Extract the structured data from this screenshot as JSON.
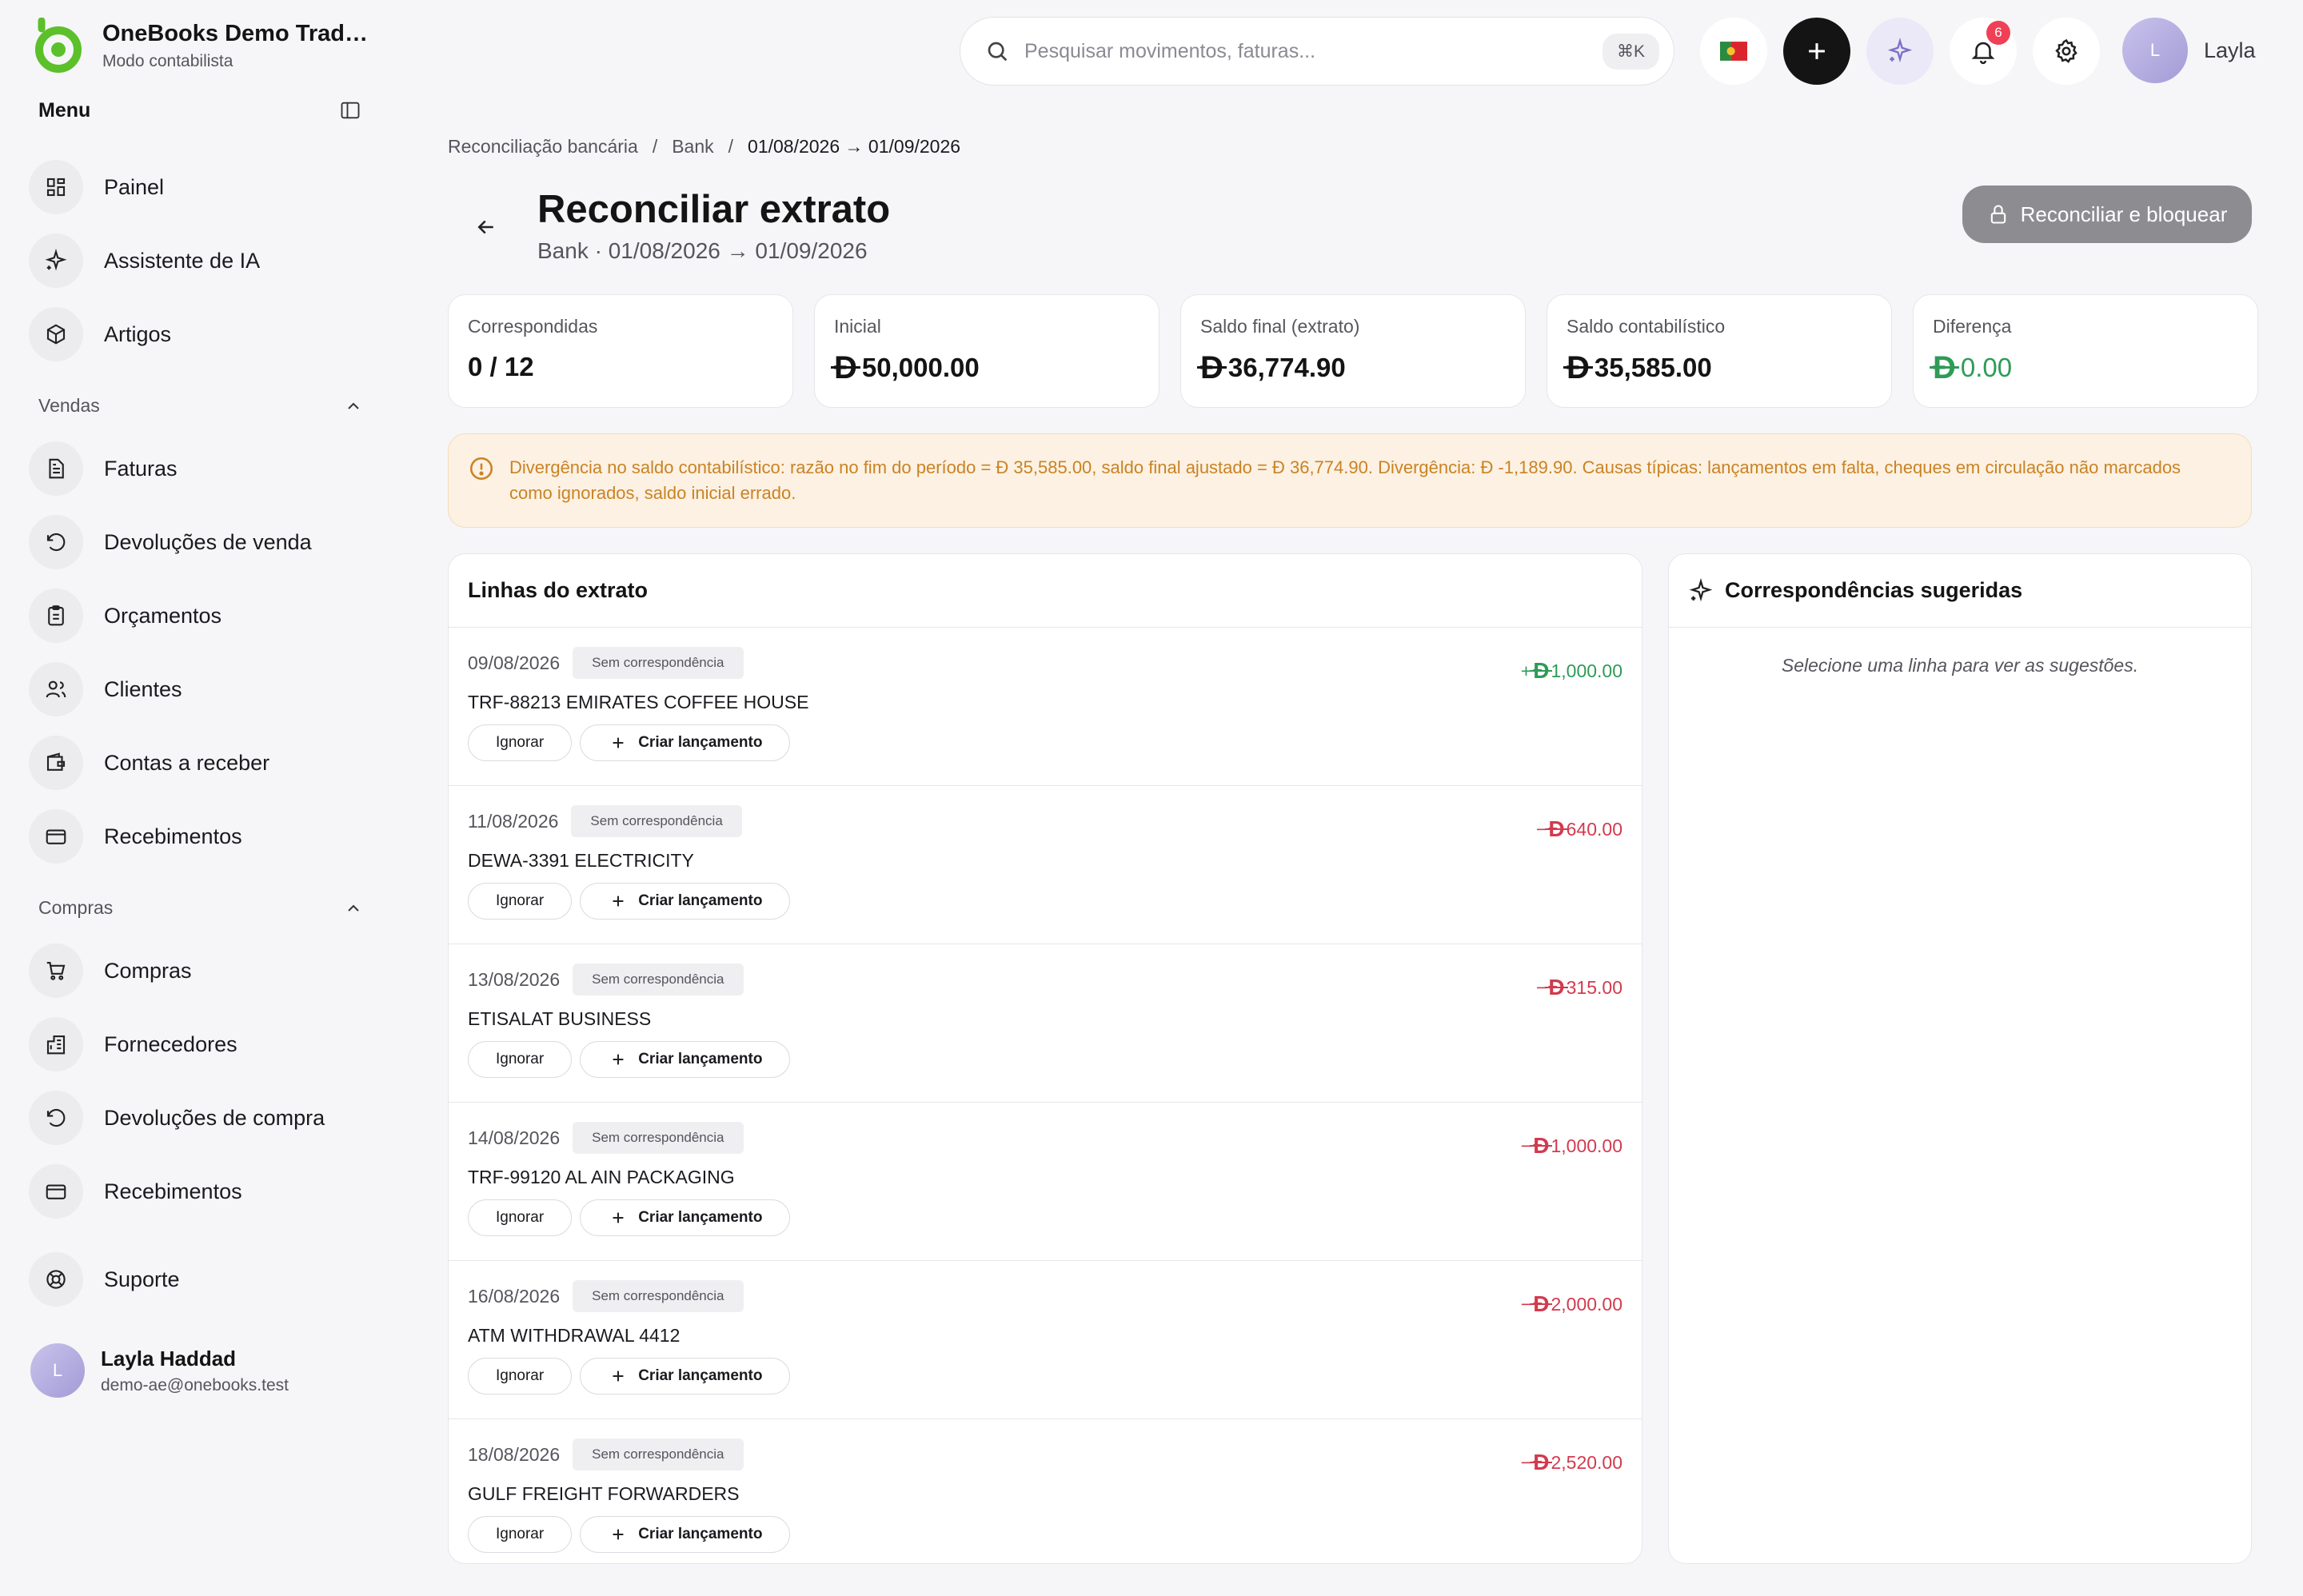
{
  "brand": {
    "name": "OneBooks Demo Tradin...",
    "mode": "Modo contabilista"
  },
  "menu": {
    "title": "Menu"
  },
  "nav_top": [
    {
      "label": "Painel",
      "icon": "dashboard-icon"
    },
    {
      "label": "Assistente de IA",
      "icon": "sparkles-icon"
    },
    {
      "label": "Artigos",
      "icon": "box-icon"
    }
  ],
  "sections": {
    "sales": {
      "title": "Vendas",
      "items": [
        {
          "label": "Faturas",
          "icon": "document-icon"
        },
        {
          "label": "Devoluções de venda",
          "icon": "undo-icon"
        },
        {
          "label": "Orçamentos",
          "icon": "clipboard-icon"
        },
        {
          "label": "Clientes",
          "icon": "users-icon"
        },
        {
          "label": "Contas a receber",
          "icon": "wallet-icon"
        },
        {
          "label": "Recebimentos",
          "icon": "card-icon"
        }
      ]
    },
    "purchases": {
      "title": "Compras",
      "items": [
        {
          "label": "Compras",
          "icon": "cart-icon"
        },
        {
          "label": "Fornecedores",
          "icon": "building-icon"
        },
        {
          "label": "Devoluções de compra",
          "icon": "undo-icon"
        },
        {
          "label": "Recebimentos",
          "icon": "card-icon"
        }
      ]
    }
  },
  "support": {
    "label": "Suporte",
    "icon": "lifebuoy-icon"
  },
  "user": {
    "initial": "L",
    "name": "Layla Haddad",
    "email": "demo-ae@onebooks.test",
    "short_name": "Layla"
  },
  "search": {
    "placeholder": "Pesquisar movimentos, faturas...",
    "shortcut": "⌘K"
  },
  "notifications": {
    "count": "6"
  },
  "breadcrumb": [
    "Reconciliação bancária",
    "Bank",
    "01/08/2026 → 01/09/2026"
  ],
  "breadcrumb_sep": "/",
  "page": {
    "title": "Reconciliar extrato",
    "subtitle": "Bank · 01/08/2026 → 01/09/2026",
    "action_label": "Reconciliar e bloquear"
  },
  "currency_symbol": "Đ",
  "stats": [
    {
      "label": "Correspondidas",
      "value": "0 / 12",
      "currency": false
    },
    {
      "label": "Inicial",
      "value": "50,000.00",
      "currency": true
    },
    {
      "label": "Saldo final (extrato)",
      "value": "36,774.90",
      "currency": true
    },
    {
      "label": "Saldo contabilístico",
      "value": "35,585.00",
      "currency": true
    },
    {
      "label": "Diferença",
      "value": "0.00",
      "currency": true,
      "color": "#2e9b57"
    }
  ],
  "alert": {
    "parts": [
      "Divergência no saldo contabilístico: razão no fim do período = ",
      "35,585.00, saldo final ajustado = ",
      "36,774.90. Divergência: ",
      "-1,189.90. Causas típicas: lançamentos em falta, cheques em circulação não marcados como ignorados, saldo inicial errado."
    ]
  },
  "lines_panel": {
    "title": "Linhas do extrato"
  },
  "line_actions": {
    "ignore": "Ignorar",
    "create": "Criar lançamento"
  },
  "statement_lines": [
    {
      "date": "09/08/2026",
      "status": "Sem correspondência",
      "description": "TRF-88213 EMIRATES COFFEE HOUSE",
      "sign": "+",
      "amount": "1,000.00",
      "direction": "in"
    },
    {
      "date": "11/08/2026",
      "status": "Sem correspondência",
      "description": "DEWA-3391 ELECTRICITY",
      "sign": "−",
      "amount": "640.00",
      "direction": "out"
    },
    {
      "date": "13/08/2026",
      "status": "Sem correspondência",
      "description": "ETISALAT BUSINESS",
      "sign": "−",
      "amount": "315.00",
      "direction": "out"
    },
    {
      "date": "14/08/2026",
      "status": "Sem correspondência",
      "description": "TRF-99120 AL AIN PACKAGING",
      "sign": "−",
      "amount": "1,000.00",
      "direction": "out"
    },
    {
      "date": "16/08/2026",
      "status": "Sem correspondência",
      "description": "ATM WITHDRAWAL 4412",
      "sign": "−",
      "amount": "2,000.00",
      "direction": "out"
    },
    {
      "date": "18/08/2026",
      "status": "Sem correspondência",
      "description": "GULF FREIGHT FORWARDERS",
      "sign": "−",
      "amount": "2,520.00",
      "direction": "out"
    }
  ],
  "suggestions_panel": {
    "title": "Correspondências sugeridas",
    "empty": "Selecione uma linha para ver as sugestões."
  },
  "colors": {
    "accent_green": "#2e9b57",
    "negative_red": "#d23a4e",
    "warning_text": "#c98325",
    "warning_bg": "#fcf1e2",
    "brand_green": "#5cc02a"
  }
}
